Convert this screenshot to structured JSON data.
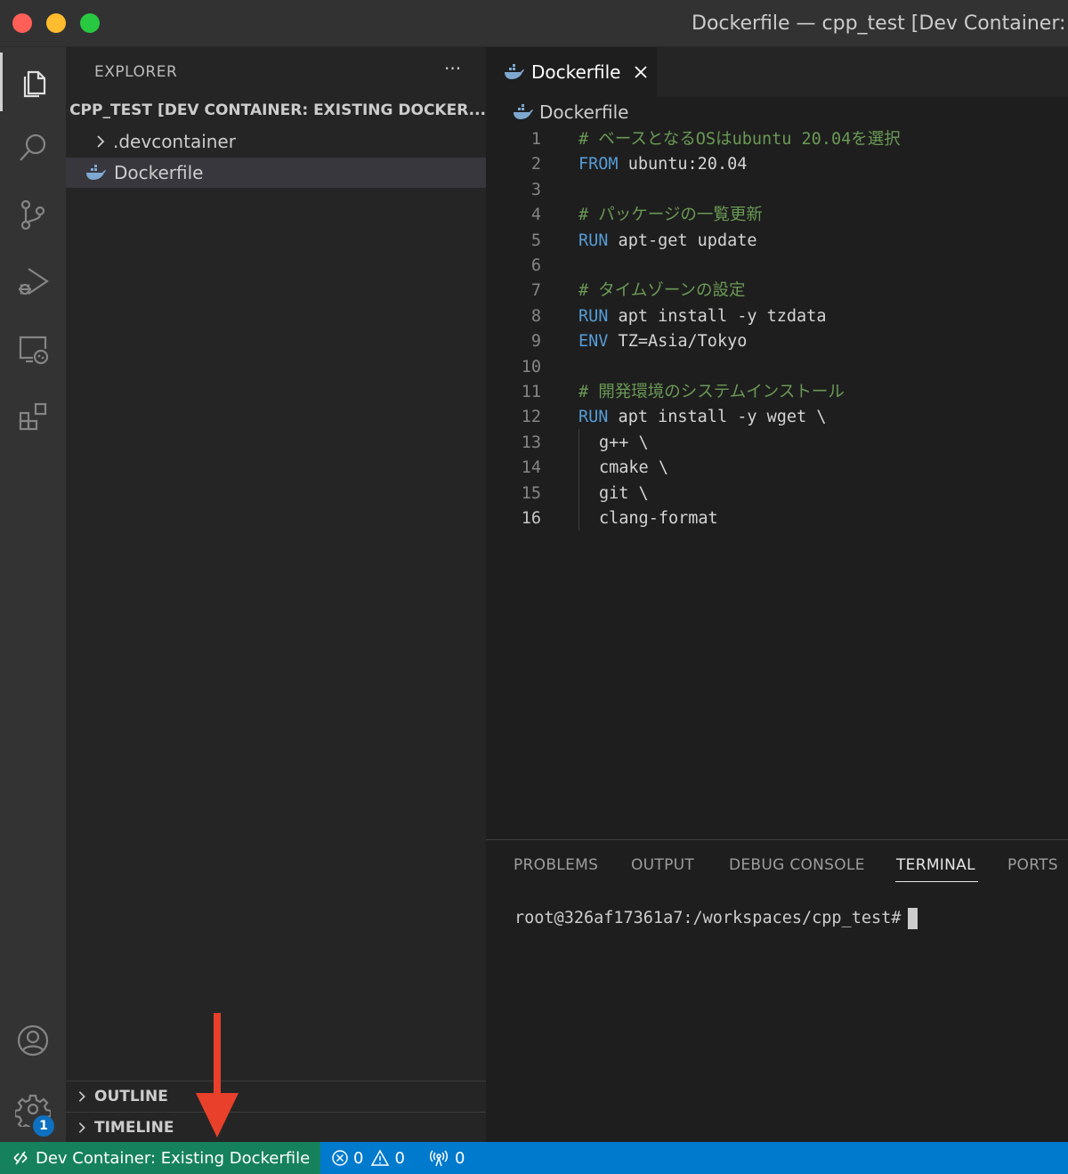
{
  "window": {
    "title": "Dockerfile — cpp_test [Dev Container: E"
  },
  "sidebar": {
    "title": "EXPLORER",
    "more_label": "···",
    "root_label": "CPP_TEST [DEV CONTAINER: EXISTING DOCKER...",
    "items": [
      {
        "label": ".devcontainer",
        "icon": "chevron-right-icon"
      },
      {
        "label": "Dockerfile",
        "icon": "docker-icon"
      }
    ],
    "outline_label": "OUTLINE",
    "timeline_label": "TIMELINE"
  },
  "editor": {
    "tab_label": "Dockerfile",
    "breadcrumb": "Dockerfile",
    "active_line": 16,
    "lines": [
      {
        "n": "1",
        "comment": "# ベースとなるOSはubuntu 20.04を選択"
      },
      {
        "n": "2",
        "kw": "FROM",
        "rest": " ubuntu:20.04"
      },
      {
        "n": "3"
      },
      {
        "n": "4",
        "comment": "# パッケージの一覧更新"
      },
      {
        "n": "5",
        "kw": "RUN",
        "rest": " apt-get update"
      },
      {
        "n": "6"
      },
      {
        "n": "7",
        "comment": "# タイムゾーンの設定"
      },
      {
        "n": "8",
        "kw": "RUN",
        "rest": " apt install -y tzdata"
      },
      {
        "n": "9",
        "kw": "ENV",
        "rest": " TZ=Asia/Tokyo"
      },
      {
        "n": "10"
      },
      {
        "n": "11",
        "comment": "# 開発環境のシステムインストール"
      },
      {
        "n": "12",
        "kw": "RUN",
        "rest": " apt install -y wget \\"
      },
      {
        "n": "13",
        "rest": "g++ \\"
      },
      {
        "n": "14",
        "rest": "cmake \\"
      },
      {
        "n": "15",
        "rest": "git \\"
      },
      {
        "n": "16",
        "rest": "clang-format"
      }
    ]
  },
  "panel": {
    "tabs": [
      "PROBLEMS",
      "OUTPUT",
      "DEBUG CONSOLE",
      "TERMINAL",
      "PORTS"
    ],
    "active_tab": "TERMINAL",
    "terminal_prompt": "root@326af17361a7:/workspaces/cpp_test#"
  },
  "statusbar": {
    "remote_label": "Dev Container: Existing Dockerfile",
    "errors": "0",
    "warnings": "0",
    "ports": "0"
  },
  "activitybar": {
    "settings_badge": "1",
    "icons": [
      "files-icon",
      "search-icon",
      "source-control-icon",
      "run-debug-icon",
      "remote-explorer-icon",
      "extensions-icon",
      "account-icon",
      "gear-icon"
    ]
  },
  "colors": {
    "statusbar": "#007acc",
    "remote_indicator": "#16825d",
    "keyword": "#569cd6",
    "comment": "#6a9955",
    "annotation_arrow": "#e8402a"
  }
}
